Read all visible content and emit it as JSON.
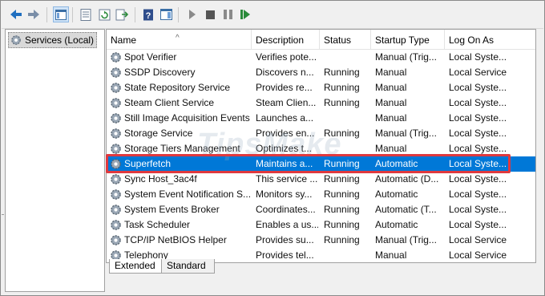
{
  "toolbar": {
    "icons": [
      "back-arrow-icon",
      "forward-arrow-icon",
      "show-hide-console-tree-icon",
      "properties-icon",
      "refresh-icon",
      "export-list-icon",
      "help-icon",
      "show-hide-action-pane-icon",
      "play-icon",
      "stop-icon",
      "pause-icon",
      "restart-icon"
    ]
  },
  "tree": {
    "root_label": "Services (Local)"
  },
  "table": {
    "columns": [
      "Name",
      "Description",
      "Status",
      "Startup Type",
      "Log On As"
    ],
    "rows": [
      {
        "name": "Spot Verifier",
        "description": "Verifies pote...",
        "status": "",
        "startup": "Manual (Trig...",
        "logon": "Local Syste..."
      },
      {
        "name": "SSDP Discovery",
        "description": "Discovers n...",
        "status": "Running",
        "startup": "Manual",
        "logon": "Local Service"
      },
      {
        "name": "State Repository Service",
        "description": "Provides re...",
        "status": "Running",
        "startup": "Manual",
        "logon": "Local Syste..."
      },
      {
        "name": "Steam Client Service",
        "description": "Steam Clien...",
        "status": "Running",
        "startup": "Manual",
        "logon": "Local Syste..."
      },
      {
        "name": "Still Image Acquisition Events",
        "description": "Launches a...",
        "status": "",
        "startup": "Manual",
        "logon": "Local Syste..."
      },
      {
        "name": "Storage Service",
        "description": "Provides en...",
        "status": "Running",
        "startup": "Manual (Trig...",
        "logon": "Local Syste..."
      },
      {
        "name": "Storage Tiers Management",
        "description": "Optimizes t...",
        "status": "",
        "startup": "Manual",
        "logon": "Local Syste..."
      },
      {
        "name": "Superfetch",
        "description": "Maintains a...",
        "status": "Running",
        "startup": "Automatic",
        "logon": "Local Syste..."
      },
      {
        "name": "Sync Host_3ac4f",
        "description": "This service ...",
        "status": "Running",
        "startup": "Automatic (D...",
        "logon": "Local Syste..."
      },
      {
        "name": "System Event Notification S...",
        "description": "Monitors sy...",
        "status": "Running",
        "startup": "Automatic",
        "logon": "Local Syste..."
      },
      {
        "name": "System Events Broker",
        "description": "Coordinates...",
        "status": "Running",
        "startup": "Automatic (T...",
        "logon": "Local Syste..."
      },
      {
        "name": "Task Scheduler",
        "description": "Enables a us...",
        "status": "Running",
        "startup": "Automatic",
        "logon": "Local Syste..."
      },
      {
        "name": "TCP/IP NetBIOS Helper",
        "description": "Provides su...",
        "status": "Running",
        "startup": "Manual (Trig...",
        "logon": "Local Service"
      },
      {
        "name": "Telephony",
        "description": "Provides tel...",
        "status": "",
        "startup": "Manual",
        "logon": "Local Service"
      }
    ],
    "selected_index": 7
  },
  "tabs": [
    "Extended",
    "Standard"
  ],
  "watermark": "TipsMake",
  "colors": {
    "selection": "#0078d7",
    "highlight_box": "#e0393e"
  }
}
